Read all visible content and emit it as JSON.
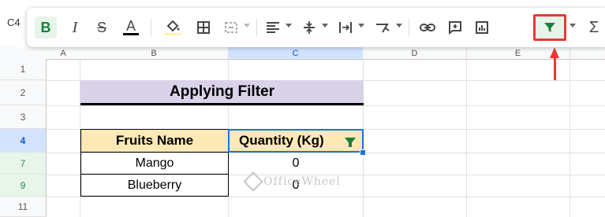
{
  "namebox": {
    "value": "C4"
  },
  "toolbar": {
    "bold_label": "B",
    "italic_label": "I",
    "strike_label": "S",
    "textcolor_label": "A",
    "sum_label": "Σ"
  },
  "columns": [
    "A",
    "B",
    "C",
    "D",
    "E"
  ],
  "rows": [
    "1",
    "2",
    "3",
    "4",
    "7",
    "9",
    "11"
  ],
  "sheet": {
    "title": "Applying Filter",
    "headers": [
      "Fruits Name",
      "Quantity (Kg)"
    ],
    "data": [
      [
        "Mango",
        "0"
      ],
      [
        "Blueberry",
        "0"
      ]
    ]
  },
  "watermark": {
    "text": "OfficeWheel"
  },
  "colors": {
    "title_bg": "#d9d2e9",
    "header_bg": "#fde9b5",
    "selection": "#1a73e8",
    "filter_icon": "#188038",
    "highlight": "#e53935"
  }
}
